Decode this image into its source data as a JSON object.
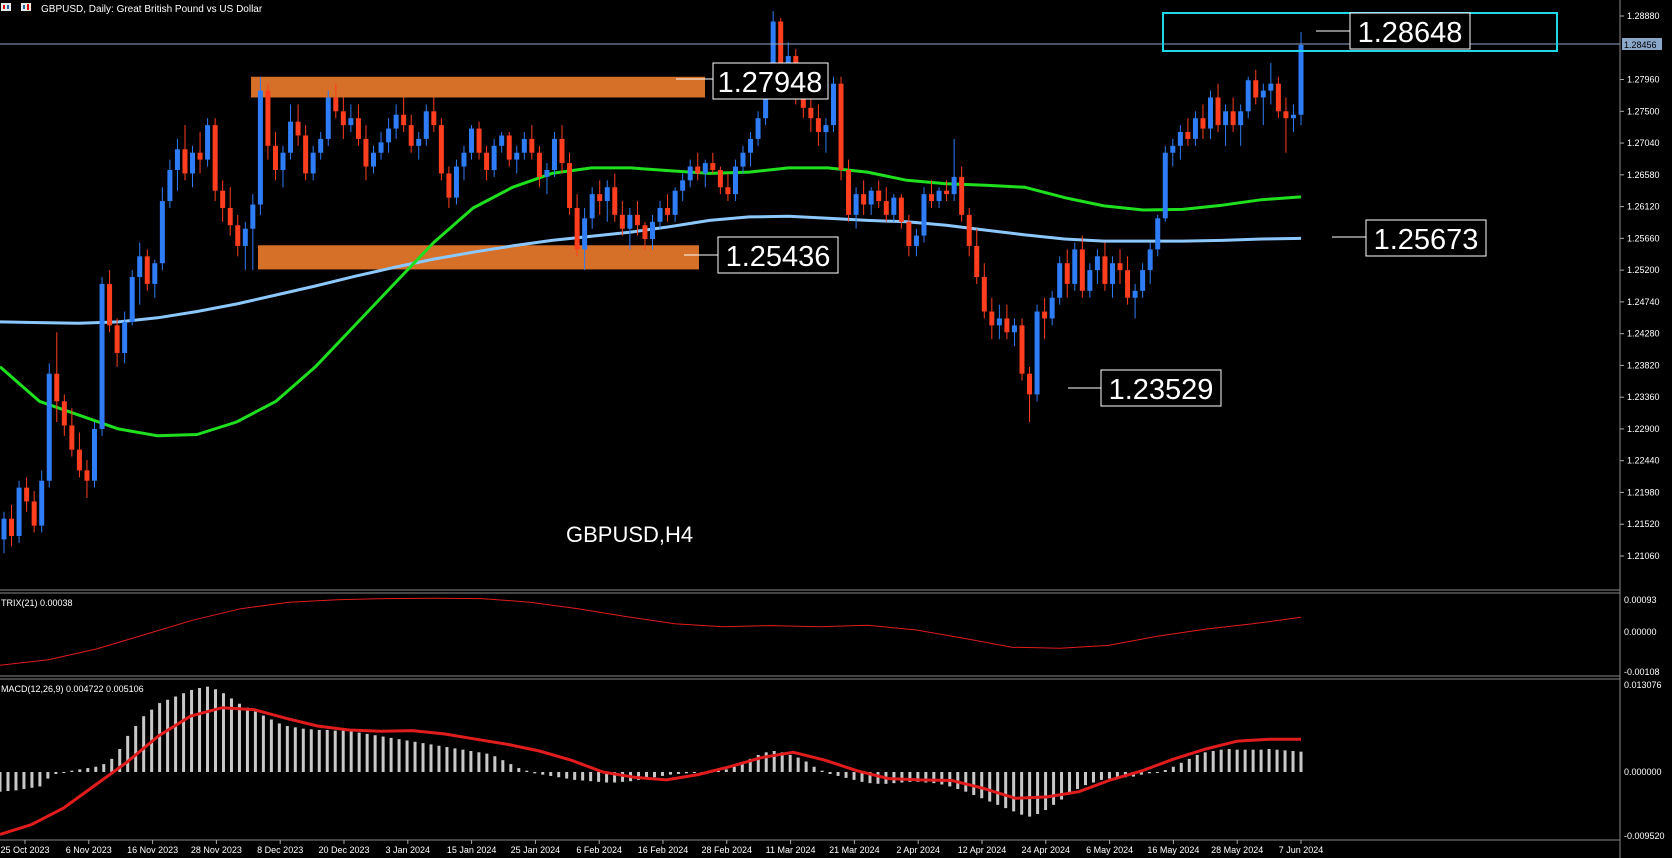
{
  "window": {
    "title": "GBPUSD, Daily:  Great British Pound vs US Dollar",
    "watermark": "GBPUSD,H4"
  },
  "colors": {
    "bull": "#2e7cf6",
    "bear": "#ff3d1f",
    "ma_fast": "#1ee01e",
    "ma_slow": "#8cc8ff",
    "zone": "#e8782a",
    "box": "#1ed8e8",
    "indicator_line": "#e01c1c",
    "histogram": "#c8c8c8"
  },
  "price_axis": {
    "ticks": [
      "1.28880",
      "1.27960",
      "1.27500",
      "1.27040",
      "1.26580",
      "1.26120",
      "1.25660",
      "1.25200",
      "1.24740",
      "1.24280",
      "1.23820",
      "1.23360",
      "1.22900",
      "1.22440",
      "1.21980",
      "1.21520",
      "1.21060"
    ],
    "current_price_label": "1.28456"
  },
  "time_axis": {
    "labels": [
      "25 Oct 2023",
      "6 Nov 2023",
      "16 Nov 2023",
      "28 Nov 2023",
      "8 Dec 2023",
      "20 Dec 2023",
      "3 Jan 2024",
      "15 Jan 2024",
      "25 Jan 2024",
      "6 Feb 2024",
      "16 Feb 2024",
      "28 Feb 2024",
      "11 Mar 2024",
      "21 Mar 2024",
      "2 Apr 2024",
      "12 Apr 2024",
      "24 Apr 2024",
      "6 May 2024",
      "16 May 2024",
      "28 May 2024",
      "7 Jun 2024"
    ]
  },
  "annotations": [
    {
      "name": "resistance-label",
      "text": "1.27948",
      "price": 1.27948
    },
    {
      "name": "support-label",
      "text": "1.25436",
      "price": 1.25436
    },
    {
      "name": "low-label",
      "text": "1.23529",
      "price": 1.23529
    },
    {
      "name": "current-high-label",
      "text": "1.28648",
      "price": 1.28648
    },
    {
      "name": "ma-label",
      "text": "1.25673",
      "price": 1.25673
    }
  ],
  "zones": [
    {
      "name": "resistance-zone",
      "top": 1.28,
      "bottom": 1.277
    },
    {
      "name": "support-zone",
      "top": 1.2556,
      "bottom": 1.2521
    }
  ],
  "trix": {
    "label": "TRIX(21) 0.00038",
    "ticks": [
      "0.00093",
      "0.00000",
      "-0.00108"
    ]
  },
  "macd": {
    "label": "MACD(12,26,9) 0.004722 0.005106",
    "ticks": [
      "0.013076",
      "0.000000",
      "-0.009520"
    ]
  },
  "chart_data": {
    "type": "candlestick",
    "symbol": "GBPUSD",
    "timeframe": "Daily",
    "ylim": [
      1.206,
      1.29
    ],
    "candles_ohlc": [
      [
        1.213,
        1.217,
        1.211,
        1.216
      ],
      [
        1.216,
        1.218,
        1.212,
        1.2135
      ],
      [
        1.2135,
        1.2215,
        1.2125,
        1.2205
      ],
      [
        1.2205,
        1.222,
        1.217,
        1.2185
      ],
      [
        1.2185,
        1.22,
        1.214,
        1.215
      ],
      [
        1.215,
        1.223,
        1.214,
        1.2215
      ],
      [
        1.2215,
        1.2385,
        1.2205,
        1.237
      ],
      [
        1.237,
        1.243,
        1.23,
        1.233
      ],
      [
        1.233,
        1.234,
        1.228,
        1.2295
      ],
      [
        1.2295,
        1.232,
        1.225,
        1.226
      ],
      [
        1.226,
        1.2285,
        1.222,
        1.223
      ],
      [
        1.223,
        1.2245,
        1.219,
        1.2215
      ],
      [
        1.2215,
        1.23,
        1.2205,
        1.229
      ],
      [
        1.229,
        1.251,
        1.228,
        1.25
      ],
      [
        1.25,
        1.252,
        1.243,
        1.244
      ],
      [
        1.244,
        1.245,
        1.238,
        1.24
      ],
      [
        1.24,
        1.246,
        1.2385,
        1.2445
      ],
      [
        1.2445,
        1.252,
        1.244,
        1.251
      ],
      [
        1.251,
        1.256,
        1.247,
        1.254
      ],
      [
        1.254,
        1.255,
        1.249,
        1.25
      ],
      [
        1.25,
        1.2535,
        1.248,
        1.253
      ],
      [
        1.253,
        1.264,
        1.252,
        1.262
      ],
      [
        1.262,
        1.268,
        1.261,
        1.2665
      ],
      [
        1.2665,
        1.271,
        1.2635,
        1.2695
      ],
      [
        1.2695,
        1.273,
        1.265,
        1.266
      ],
      [
        1.266,
        1.27,
        1.264,
        1.269
      ],
      [
        1.269,
        1.272,
        1.266,
        1.268
      ],
      [
        1.268,
        1.274,
        1.267,
        1.273
      ],
      [
        1.273,
        1.274,
        1.262,
        1.2635
      ],
      [
        1.2635,
        1.265,
        1.259,
        1.261
      ],
      [
        1.261,
        1.264,
        1.257,
        1.2585
      ],
      [
        1.2585,
        1.26,
        1.254,
        1.2555
      ],
      [
        1.2555,
        1.259,
        1.252,
        1.258
      ],
      [
        1.258,
        1.263,
        1.252,
        1.2615
      ],
      [
        1.2615,
        1.28,
        1.26,
        1.278
      ],
      [
        1.278,
        1.279,
        1.268,
        1.27
      ],
      [
        1.27,
        1.272,
        1.265,
        1.2665
      ],
      [
        1.2665,
        1.27,
        1.264,
        1.269
      ],
      [
        1.269,
        1.276,
        1.268,
        1.2735
      ],
      [
        1.2735,
        1.276,
        1.27,
        1.2715
      ],
      [
        1.2715,
        1.273,
        1.265,
        1.266
      ],
      [
        1.266,
        1.27,
        1.265,
        1.269
      ],
      [
        1.269,
        1.272,
        1.268,
        1.271
      ],
      [
        1.271,
        1.278,
        1.27,
        1.277
      ],
      [
        1.277,
        1.279,
        1.274,
        1.275
      ],
      [
        1.275,
        1.277,
        1.271,
        1.273
      ],
      [
        1.273,
        1.276,
        1.272,
        1.274
      ],
      [
        1.274,
        1.276,
        1.27,
        1.271
      ],
      [
        1.271,
        1.273,
        1.265,
        1.267
      ],
      [
        1.267,
        1.27,
        1.266,
        1.269
      ],
      [
        1.269,
        1.272,
        1.268,
        1.2705
      ],
      [
        1.2705,
        1.274,
        1.269,
        1.2725
      ],
      [
        1.2725,
        1.276,
        1.271,
        1.2745
      ],
      [
        1.2745,
        1.277,
        1.272,
        1.273
      ],
      [
        1.273,
        1.2745,
        1.269,
        1.27
      ],
      [
        1.27,
        1.272,
        1.268,
        1.271
      ],
      [
        1.271,
        1.276,
        1.27,
        1.275
      ],
      [
        1.275,
        1.277,
        1.272,
        1.273
      ],
      [
        1.273,
        1.274,
        1.265,
        1.266
      ],
      [
        1.266,
        1.267,
        1.261,
        1.2625
      ],
      [
        1.2625,
        1.268,
        1.2615,
        1.267
      ],
      [
        1.267,
        1.27,
        1.265,
        1.269
      ],
      [
        1.269,
        1.273,
        1.268,
        1.2725
      ],
      [
        1.2725,
        1.2735,
        1.268,
        1.269
      ],
      [
        1.269,
        1.27,
        1.265,
        1.2665
      ],
      [
        1.2665,
        1.271,
        1.2655,
        1.27
      ],
      [
        1.27,
        1.272,
        1.269,
        1.2715
      ],
      [
        1.2715,
        1.272,
        1.267,
        1.268
      ],
      [
        1.268,
        1.27,
        1.266,
        1.269
      ],
      [
        1.269,
        1.272,
        1.268,
        1.271
      ],
      [
        1.271,
        1.273,
        1.268,
        1.269
      ],
      [
        1.269,
        1.27,
        1.264,
        1.2655
      ],
      [
        1.2655,
        1.2675,
        1.263,
        1.2665
      ],
      [
        1.2665,
        1.272,
        1.2655,
        1.271
      ],
      [
        1.271,
        1.273,
        1.266,
        1.2675
      ],
      [
        1.2675,
        1.269,
        1.26,
        1.261
      ],
      [
        1.261,
        1.263,
        1.254,
        1.255
      ],
      [
        1.255,
        1.261,
        1.252,
        1.2595
      ],
      [
        1.2595,
        1.264,
        1.258,
        1.263
      ],
      [
        1.263,
        1.265,
        1.26,
        1.262
      ],
      [
        1.262,
        1.265,
        1.259,
        1.264
      ],
      [
        1.264,
        1.266,
        1.259,
        1.26
      ],
      [
        1.26,
        1.262,
        1.257,
        1.258
      ],
      [
        1.258,
        1.261,
        1.255,
        1.26
      ],
      [
        1.26,
        1.262,
        1.257,
        1.2585
      ],
      [
        1.2585,
        1.259,
        1.255,
        1.2565
      ],
      [
        1.2565,
        1.26,
        1.255,
        1.259
      ],
      [
        1.259,
        1.262,
        1.258,
        1.261
      ],
      [
        1.261,
        1.263,
        1.259,
        1.26
      ],
      [
        1.26,
        1.264,
        1.259,
        1.2635
      ],
      [
        1.2635,
        1.266,
        1.262,
        1.265
      ],
      [
        1.265,
        1.268,
        1.264,
        1.267
      ],
      [
        1.267,
        1.269,
        1.265,
        1.266
      ],
      [
        1.266,
        1.268,
        1.264,
        1.2675
      ],
      [
        1.2675,
        1.269,
        1.266,
        1.2665
      ],
      [
        1.2665,
        1.267,
        1.263,
        1.264
      ],
      [
        1.264,
        1.266,
        1.262,
        1.263
      ],
      [
        1.263,
        1.268,
        1.262,
        1.267
      ],
      [
        1.267,
        1.27,
        1.266,
        1.269
      ],
      [
        1.269,
        1.272,
        1.267,
        1.271
      ],
      [
        1.271,
        1.275,
        1.27,
        1.274
      ],
      [
        1.274,
        1.28,
        1.273,
        1.279
      ],
      [
        1.279,
        1.2895,
        1.278,
        1.288
      ],
      [
        1.288,
        1.2885,
        1.28,
        1.281
      ],
      [
        1.281,
        1.285,
        1.279,
        1.283
      ],
      [
        1.283,
        1.284,
        1.276,
        1.2775
      ],
      [
        1.2775,
        1.28,
        1.274,
        1.2755
      ],
      [
        1.2755,
        1.277,
        1.272,
        1.274
      ],
      [
        1.274,
        1.276,
        1.27,
        1.272
      ],
      [
        1.272,
        1.274,
        1.269,
        1.273
      ],
      [
        1.273,
        1.28,
        1.272,
        1.279
      ],
      [
        1.279,
        1.28,
        1.265,
        1.2665
      ],
      [
        1.2665,
        1.268,
        1.259,
        1.26
      ],
      [
        1.26,
        1.264,
        1.258,
        1.263
      ],
      [
        1.263,
        1.265,
        1.26,
        1.2615
      ],
      [
        1.2615,
        1.264,
        1.26,
        1.2635
      ],
      [
        1.2635,
        1.265,
        1.261,
        1.262
      ],
      [
        1.262,
        1.264,
        1.259,
        1.26
      ],
      [
        1.26,
        1.263,
        1.259,
        1.2625
      ],
      [
        1.2625,
        1.263,
        1.258,
        1.259
      ],
      [
        1.259,
        1.26,
        1.254,
        1.2555
      ],
      [
        1.2555,
        1.258,
        1.254,
        1.257
      ],
      [
        1.257,
        1.264,
        1.256,
        1.263
      ],
      [
        1.263,
        1.265,
        1.261,
        1.262
      ],
      [
        1.262,
        1.264,
        1.261,
        1.2635
      ],
      [
        1.2635,
        1.265,
        1.262,
        1.263
      ],
      [
        1.263,
        1.271,
        1.262,
        1.2655
      ],
      [
        1.2655,
        1.267,
        1.259,
        1.26
      ],
      [
        1.26,
        1.261,
        1.254,
        1.2555
      ],
      [
        1.2555,
        1.258,
        1.25,
        1.251
      ],
      [
        1.251,
        1.253,
        1.245,
        1.246
      ],
      [
        1.246,
        1.248,
        1.242,
        1.244
      ],
      [
        1.244,
        1.247,
        1.242,
        1.245
      ],
      [
        1.245,
        1.247,
        1.242,
        1.243
      ],
      [
        1.243,
        1.245,
        1.241,
        1.244
      ],
      [
        1.244,
        1.245,
        1.236,
        1.237
      ],
      [
        1.237,
        1.238,
        1.23,
        1.234
      ],
      [
        1.234,
        1.247,
        1.233,
        1.246
      ],
      [
        1.246,
        1.248,
        1.242,
        1.245
      ],
      [
        1.245,
        1.249,
        1.244,
        1.248
      ],
      [
        1.248,
        1.254,
        1.247,
        1.253
      ],
      [
        1.253,
        1.255,
        1.248,
        1.25
      ],
      [
        1.25,
        1.256,
        1.249,
        1.255
      ],
      [
        1.255,
        1.257,
        1.248,
        1.249
      ],
      [
        1.249,
        1.253,
        1.248,
        1.252
      ],
      [
        1.252,
        1.255,
        1.25,
        1.254
      ],
      [
        1.254,
        1.256,
        1.249,
        1.25
      ],
      [
        1.25,
        1.254,
        1.248,
        1.253
      ],
      [
        1.253,
        1.255,
        1.25,
        1.252
      ],
      [
        1.252,
        1.254,
        1.247,
        1.248
      ],
      [
        1.248,
        1.25,
        1.245,
        1.249
      ],
      [
        1.249,
        1.253,
        1.248,
        1.252
      ],
      [
        1.252,
        1.256,
        1.25,
        1.255
      ],
      [
        1.255,
        1.26,
        1.254,
        1.2595
      ],
      [
        1.2595,
        1.27,
        1.259,
        1.269
      ],
      [
        1.269,
        1.271,
        1.267,
        1.27
      ],
      [
        1.27,
        1.273,
        1.268,
        1.272
      ],
      [
        1.272,
        1.274,
        1.27,
        1.271
      ],
      [
        1.271,
        1.275,
        1.27,
        1.274
      ],
      [
        1.274,
        1.276,
        1.271,
        1.2725
      ],
      [
        1.2725,
        1.278,
        1.271,
        1.277
      ],
      [
        1.277,
        1.279,
        1.272,
        1.273
      ],
      [
        1.273,
        1.276,
        1.27,
        1.275
      ],
      [
        1.275,
        1.277,
        1.272,
        1.273
      ],
      [
        1.273,
        1.276,
        1.27,
        1.275
      ],
      [
        1.275,
        1.28,
        1.274,
        1.2795
      ],
      [
        1.2795,
        1.281,
        1.276,
        1.277
      ],
      [
        1.277,
        1.279,
        1.273,
        1.278
      ],
      [
        1.278,
        1.282,
        1.276,
        1.279
      ],
      [
        1.279,
        1.28,
        1.274,
        1.275
      ],
      [
        1.275,
        1.277,
        1.269,
        1.274
      ],
      [
        1.274,
        1.276,
        1.272,
        1.2745
      ],
      [
        1.2745,
        1.2865,
        1.273,
        1.2846
      ]
    ],
    "ma_fast_values": [
      1.238,
      1.233,
      1.231,
      1.229,
      1.228,
      1.2282,
      1.23,
      1.233,
      1.238,
      1.244,
      1.25,
      1.256,
      1.261,
      1.264,
      1.266,
      1.2668,
      1.2668,
      1.2664,
      1.266,
      1.2662,
      1.2668,
      1.2668,
      1.2662,
      1.265,
      1.2645,
      1.2643,
      1.264,
      1.2625,
      1.2613,
      1.2607,
      1.2608,
      1.2614,
      1.2622,
      1.2626
    ],
    "ma_slow_values": [
      1.2445,
      1.2444,
      1.2443,
      1.2445,
      1.2451,
      1.246,
      1.2471,
      1.2484,
      1.2497,
      1.2511,
      1.2524,
      1.2536,
      1.2546,
      1.2555,
      1.2563,
      1.2569,
      1.2575,
      1.2583,
      1.2592,
      1.2597,
      1.2598,
      1.2595,
      1.2592,
      1.259,
      1.2585,
      1.2578,
      1.2571,
      1.2565,
      1.2562,
      1.2562,
      1.2562,
      1.2563,
      1.2565,
      1.2566
    ],
    "trix_values": [
      -0.00095,
      -0.0008,
      -0.0005,
      -0.0001,
      0.0003,
      0.00062,
      0.0008,
      0.00087,
      0.0009,
      0.00091,
      0.0009,
      0.0008,
      0.00062,
      0.0004,
      0.0002,
      0.00012,
      0.00015,
      0.00012,
      0.00016,
      3e-05,
      -0.0002,
      -0.00045,
      -0.00048,
      -0.0004,
      -0.00015,
      5e-05,
      0.0002,
      0.00038
    ],
    "macd_hist": [
      -0.003,
      -0.0029,
      -0.0028,
      -0.0026,
      -0.0024,
      -0.0022,
      -0.001,
      -0.0003,
      0.0,
      0.0002,
      0.0004,
      0.0006,
      0.0008,
      0.0012,
      0.002,
      0.0035,
      0.0055,
      0.007,
      0.0085,
      0.0095,
      0.0105,
      0.011,
      0.0115,
      0.012,
      0.0125,
      0.0128,
      0.013,
      0.0126,
      0.012,
      0.0112,
      0.0104,
      0.0098,
      0.0092,
      0.0086,
      0.008,
      0.0074,
      0.007,
      0.0068,
      0.0066,
      0.0065,
      0.0064,
      0.0064,
      0.0063,
      0.0063,
      0.0062,
      0.006,
      0.0058,
      0.0056,
      0.0054,
      0.0052,
      0.005,
      0.0048,
      0.0046,
      0.0044,
      0.0042,
      0.004,
      0.0038,
      0.0036,
      0.0034,
      0.0032,
      0.003,
      0.0028,
      0.0024,
      0.0018,
      0.0012,
      0.0006,
      0.0002,
      -0.0002,
      -0.0004,
      -0.0006,
      -0.0008,
      -0.001,
      -0.0012,
      -0.0013,
      -0.0014,
      -0.0015,
      -0.0016,
      -0.0016,
      -0.0015,
      -0.0014,
      -0.0012,
      -0.001,
      -0.0008,
      -0.0006,
      -0.0004,
      -0.0003,
      -0.0002,
      -0.0001,
      0.0,
      0.0001,
      0.0002,
      0.0004,
      0.0008,
      0.0014,
      0.002,
      0.0026,
      0.003,
      0.0032,
      0.003,
      0.0026,
      0.0022,
      0.0016,
      0.0008,
      0.0002,
      -0.0003,
      -0.0006,
      -0.0009,
      -0.0012,
      -0.0015,
      -0.0017,
      -0.0018,
      -0.0018,
      -0.0017,
      -0.0016,
      -0.0015,
      -0.0015,
      -0.0016,
      -0.0017,
      -0.0019,
      -0.0022,
      -0.0026,
      -0.003,
      -0.0035,
      -0.004,
      -0.0045,
      -0.005,
      -0.0055,
      -0.006,
      -0.0065,
      -0.0068,
      -0.0064,
      -0.0058,
      -0.005,
      -0.0042,
      -0.0034,
      -0.0026,
      -0.002,
      -0.0016,
      -0.0012,
      -0.001,
      -0.0009,
      -0.0008,
      -0.0007,
      -0.0004,
      -0.0002,
      0.0,
      0.0003,
      0.0008,
      0.0014,
      0.002,
      0.0026,
      0.003,
      0.0032,
      0.0034,
      0.0035,
      0.0034,
      0.0034,
      0.0034,
      0.0034,
      0.0035,
      0.0034,
      0.0033,
      0.0032,
      0.0031
    ],
    "macd_signal": [
      -0.0095,
      -0.008,
      -0.0055,
      -0.002,
      0.0015,
      0.0055,
      0.0085,
      0.0098,
      0.0095,
      0.0082,
      0.007,
      0.0064,
      0.0062,
      0.0063,
      0.0058,
      0.005,
      0.0042,
      0.0032,
      0.0018,
      0.0,
      -0.0008,
      -0.0012,
      -0.0004,
      0.0008,
      0.0022,
      0.003,
      0.0018,
      0.0002,
      -0.001,
      -0.0012,
      -0.0013,
      -0.0025,
      -0.004,
      -0.0038,
      -0.003,
      -0.0012,
      0.0002,
      0.002,
      0.0035,
      0.0047,
      0.005,
      0.005
    ]
  }
}
